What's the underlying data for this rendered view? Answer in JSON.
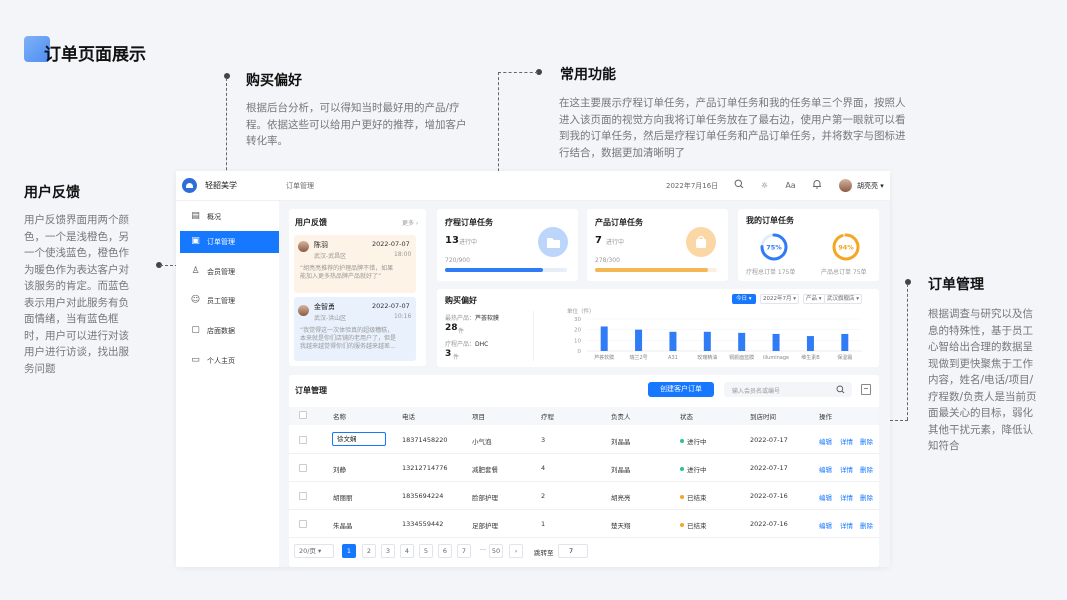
{
  "page_title": "订单页面展示",
  "annotations": {
    "purchase": {
      "title": "购买偏好",
      "text": [
        "根据后台分析，可以得知当时最好用的产品/疗",
        "程。依据这些可以给用户更好的推荐，增加客户",
        "转化率。"
      ]
    },
    "common": {
      "title": "常用功能",
      "text": [
        "在这主要展示疗程订单任务，产品订单任务和我的任务单三个界面，按照人",
        "进入该页面的视觉方向我将订单任务放在了最右边，使用户第一眼就可以看",
        "到我的订单任务，然后是疗程订单任务和产品订单任务，并将数字与图标进",
        "行结合，数据更加清晰明了"
      ]
    },
    "feedback": {
      "title": "用户反馈",
      "text": [
        "用户反馈界面用两个颜",
        "色，一个是浅橙色，另",
        "一个使浅蓝色，橙色作",
        "为暖色作为表达客户对",
        "该服务的肯定。而蓝色",
        "表示用户对此服务有负",
        "面情绪，当有蓝色框",
        "时，用户可以进行对该",
        "用户进行访谈，找出服",
        "务问题"
      ]
    },
    "order": {
      "title": "订单管理",
      "text": [
        "根据调查与研究以及信",
        "息的特殊性，基于员工",
        "心智给出合理的数据呈",
        "现做到更快聚焦于工作",
        "内容，姓名/电话/项目/",
        "疗程数/负责人是当前页",
        "面最关心的目标，弱化",
        "其他干扰元素，降低认",
        "知符合"
      ]
    }
  },
  "app": {
    "brand": "轻韶美学",
    "breadcrumb": "订单管理",
    "date": "2022年7月16日",
    "font_icon_label": "Aa",
    "user_name": "胡亮亮 ▾",
    "nav": [
      "概况",
      "订单管理",
      "会员管理",
      "员工管理",
      "店面数据",
      "个人主页"
    ]
  },
  "feedback": {
    "title": "用户反馈",
    "more": "更多 ›",
    "items": [
      {
        "name": "陈羽",
        "date": "2022-07-07",
        "loc": "武汉-武昌区",
        "time": "18:00",
        "text": [
          "“胡亮亮推荐的护理品牌不错，如果",
          "能加入更多热品牌产品就好了”"
        ]
      },
      {
        "name": "金智勇",
        "date": "2022-07-07",
        "loc": "武汉-洪山区",
        "time": "10:16",
        "text": [
          "“我觉得这一次体验真的超级糟糕，",
          "本来就是你们店铺的老用户了，但是",
          "我越来越觉得你们的服务越来越差..."
        ]
      }
    ]
  },
  "course_task": {
    "title": "疗程订单任务",
    "count": "13",
    "label": "进行中",
    "progress": "720/900",
    "ratio": 0.8
  },
  "product_task": {
    "title": "产品订单任务",
    "count": "7",
    "label": "进行中",
    "progress": "278/300",
    "ratio": 0.93
  },
  "my_task": {
    "title": "我的订单任务",
    "items": [
      {
        "pct": "75%",
        "label": "疗程总订单 175单",
        "value": 0.75,
        "color": "#2f7cf6"
      },
      {
        "pct": "94%",
        "label": "产品总订单 75单",
        "value": 0.94,
        "color": "#f5a623"
      }
    ]
  },
  "preference": {
    "title": "购买偏好",
    "filters": [
      "今日 ▾",
      "2022年7月 ▾",
      "产品 ▾",
      "武汉旗舰店 ▾"
    ],
    "best_product_label": "最热产品：",
    "best_product": "芦荟软膜",
    "best_product_count": "28",
    "best_course_label": "疗程产品：",
    "best_course": "DHC",
    "best_course_count": "3",
    "unit": "件",
    "unit_label": "单位（件）"
  },
  "chart_data": {
    "type": "bar",
    "categories": [
      "芦荟软膜",
      "瑞兰2号",
      "A31",
      "玫瑰精油",
      "铜颜面蓝膜",
      "illuminage",
      "维生素B",
      "保湿霜"
    ],
    "values": [
      23,
      20,
      18,
      18,
      17,
      16,
      14,
      16
    ],
    "ylabel": "单位（件）",
    "ylim": [
      0,
      30
    ],
    "yticks": [
      "30",
      "20",
      "10",
      "0"
    ]
  },
  "orders": {
    "title": "订单管理",
    "create_label": "创建客户订单",
    "search_placeholder": "输入会员名或编号",
    "headers": [
      "名称",
      "电话",
      "项目",
      "疗程",
      "负责人",
      "状态",
      "到店时间",
      "操作"
    ],
    "rows": [
      {
        "name": "徐文娴",
        "phone": "18371458220",
        "project": "小气泡",
        "course": "3",
        "owner": "刘晶晶",
        "status": "进行中",
        "status_color": "#2bc48a",
        "date": "2022-07-17"
      },
      {
        "name": "刘静",
        "phone": "13212714776",
        "project": "减肥套餐",
        "course": "4",
        "owner": "刘晶晶",
        "status": "进行中",
        "status_color": "#2bc48a",
        "date": "2022-07-17"
      },
      {
        "name": "胡丽丽",
        "phone": "1835694224",
        "project": "脸部护理",
        "course": "2",
        "owner": "胡亮亮",
        "status": "已结束",
        "status_color": "#f5a623",
        "date": "2022-07-16"
      },
      {
        "name": "朱晶晶",
        "phone": "1334559442",
        "project": "足部护理",
        "course": "1",
        "owner": "楚天翔",
        "status": "已结束",
        "status_color": "#f5a623",
        "date": "2022-07-16"
      }
    ],
    "actions": [
      "编辑",
      "详情",
      "删除"
    ],
    "page_size": "20/页 ▾",
    "pages": [
      "‹",
      "1",
      "2",
      "3",
      "4",
      "5",
      "6",
      "7",
      "···",
      "50",
      "›"
    ],
    "goto_label": "跳转至",
    "goto_value": "7"
  },
  "colors": {
    "primary": "#1677ff",
    "orange": "#f5a623",
    "green": "#2bc48a"
  }
}
